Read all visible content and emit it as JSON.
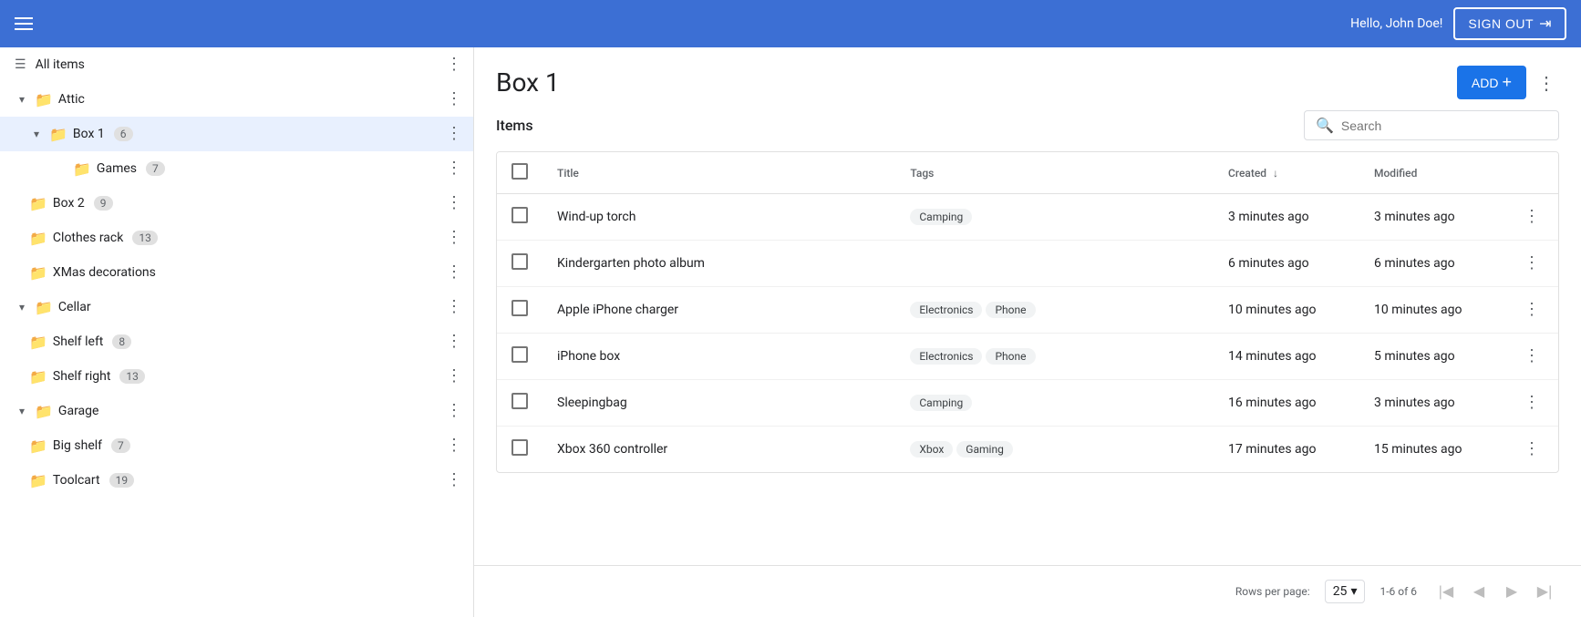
{
  "topbar": {
    "greeting": "Hello, John Doe!",
    "signout_label": "SIGN OUT"
  },
  "sidebar": {
    "all_items_label": "All items",
    "sections": [
      {
        "name": "Attic",
        "expanded": true,
        "items": [
          {
            "name": "Box 1",
            "count": 6,
            "selected": true,
            "expanded": true,
            "children": [
              {
                "name": "Games",
                "count": 7
              }
            ]
          },
          {
            "name": "Box 2",
            "count": 9
          },
          {
            "name": "Clothes rack",
            "count": 13
          },
          {
            "name": "XMas decorations",
            "count": null
          }
        ]
      },
      {
        "name": "Cellar",
        "expanded": true,
        "items": [
          {
            "name": "Shelf left",
            "count": 8
          },
          {
            "name": "Shelf right",
            "count": 13
          }
        ]
      },
      {
        "name": "Garage",
        "expanded": true,
        "items": [
          {
            "name": "Big shelf",
            "count": 7
          },
          {
            "name": "Toolcart",
            "count": 19
          }
        ]
      }
    ]
  },
  "content": {
    "title": "Box 1",
    "add_label": "ADD",
    "section_title": "Items",
    "search_placeholder": "Search",
    "columns": {
      "title": "Title",
      "tags": "Tags",
      "created": "Created",
      "modified": "Modified"
    },
    "rows": [
      {
        "title": "Wind-up torch",
        "tags": [
          "Camping"
        ],
        "created": "3 minutes ago",
        "modified": "3 minutes ago"
      },
      {
        "title": "Kindergarten photo album",
        "tags": [],
        "created": "6 minutes ago",
        "modified": "6 minutes ago"
      },
      {
        "title": "Apple iPhone charger",
        "tags": [
          "Electronics",
          "Phone"
        ],
        "created": "10 minutes ago",
        "modified": "10 minutes ago"
      },
      {
        "title": "iPhone box",
        "tags": [
          "Electronics",
          "Phone"
        ],
        "created": "14 minutes ago",
        "modified": "5 minutes ago"
      },
      {
        "title": "Sleepingbag",
        "tags": [
          "Camping"
        ],
        "created": "16 minutes ago",
        "modified": "3 minutes ago"
      },
      {
        "title": "Xbox 360 controller",
        "tags": [
          "Xbox",
          "Gaming"
        ],
        "created": "17 minutes ago",
        "modified": "15 minutes ago"
      }
    ],
    "pagination": {
      "rows_per_page_label": "Rows per page:",
      "rows_per_page_value": "25",
      "page_info": "1-6 of 6"
    }
  }
}
